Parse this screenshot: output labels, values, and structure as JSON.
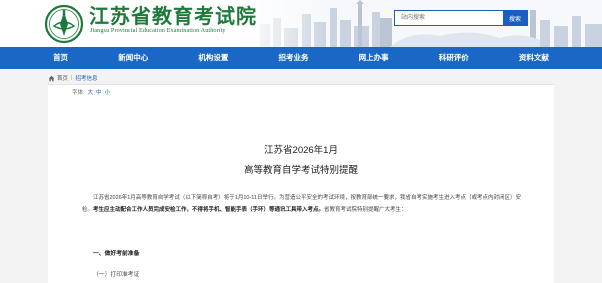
{
  "header": {
    "site_name": "江苏省教育考试院",
    "site_name_en": "Jiangsu Provincial Education Examination Authority",
    "search_placeholder": "站内搜索",
    "search_button": "搜索"
  },
  "nav": [
    "首页",
    "新闻中心",
    "机构设置",
    "招考业务",
    "网上办事",
    "科研评价",
    "资料文献"
  ],
  "breadcrumb": {
    "home": "首页",
    "separator": "|",
    "current": "招考信息"
  },
  "fontsize": {
    "label": "字体:",
    "options": [
      "大",
      "中",
      "小"
    ]
  },
  "article": {
    "title_line1": "江苏省2026年1月",
    "title_line2": "高等教育自学考试特别提醒",
    "para_normal1": "江苏省2026年1月高等教育自学考试（以下简称自考）将于1月10-11日举行。为营造公平安全的考试环境，按教育部统一要求，我省自考实施考生进入考点（或考点内封闭区）安检。",
    "para_bold": "考生应主动配合工作人员完成安检工作，不得将手机、智能手表（手环）等通讯工具带入考点。",
    "para_normal2": "省教育考试院特别提醒广大考生：",
    "section1": "一、做好考前准备",
    "subsection1": "（一）打印准考证"
  },
  "colors": {
    "nav_bg": "#1a67c6",
    "brand_green": "#1d7a3a",
    "link_blue": "#1a5fc0"
  }
}
